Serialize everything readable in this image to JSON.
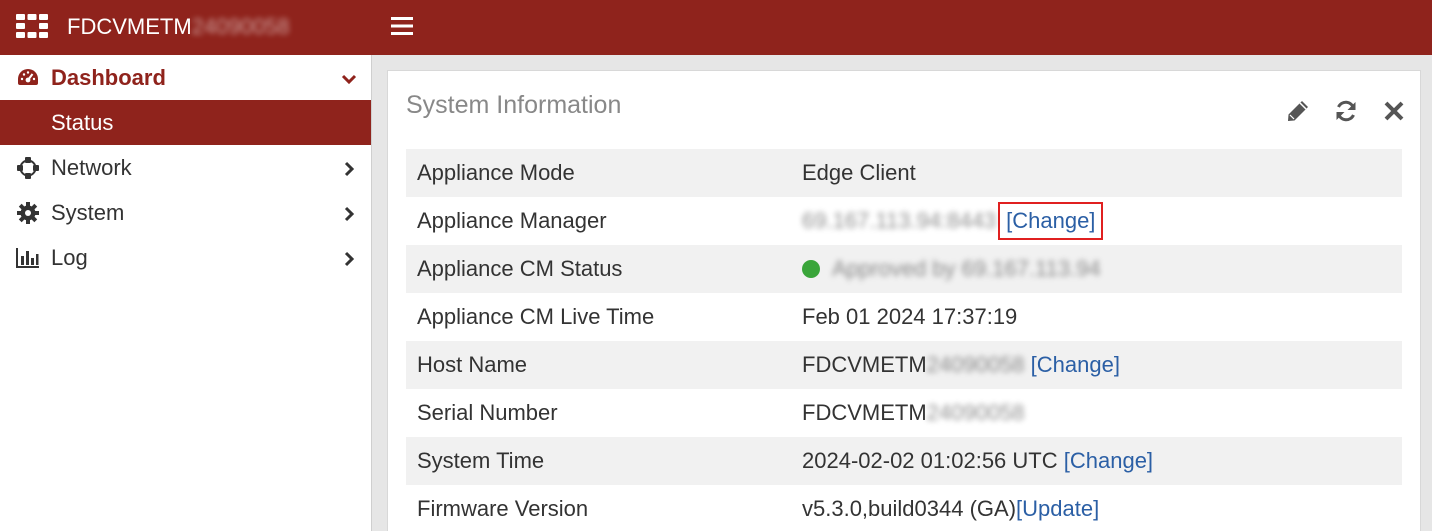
{
  "header": {
    "hostname_prefix": "FDCVMETM",
    "hostname_suffix": "24090058",
    "logo_icon": "fortinet-logo-icon",
    "menu_icon": "hamburger-menu-icon"
  },
  "sidebar": {
    "items": [
      {
        "label": "Dashboard",
        "icon": "dashboard-gauge-icon",
        "expanded": true,
        "children": [
          {
            "label": "Status",
            "selected": true
          }
        ]
      },
      {
        "label": "Network",
        "icon": "network-icon",
        "expanded": false
      },
      {
        "label": "System",
        "icon": "gear-icon",
        "expanded": false
      },
      {
        "label": "Log",
        "icon": "bar-chart-icon",
        "expanded": false
      }
    ]
  },
  "panel": {
    "title": "System Information",
    "tools": [
      "pencil-icon",
      "refresh-icon",
      "close-icon"
    ]
  },
  "system_info": {
    "rows": [
      {
        "label": "Appliance Mode",
        "value": "Edge Client"
      },
      {
        "label": "Appliance Manager",
        "value": "69.167.113.94:8443",
        "link": "[Change]"
      },
      {
        "label": "Appliance CM Status",
        "value": "Approved by 69.167.113.94"
      },
      {
        "label": "Appliance CM Live Time",
        "value": "Feb 01 2024 17:37:19"
      },
      {
        "label": "Host Name",
        "value_prefix": "FDCVMETM",
        "value_suffix": "24090058",
        "link": "[Change]"
      },
      {
        "label": "Serial Number",
        "value_prefix": "FDCVMETM",
        "value_suffix": "24090058"
      },
      {
        "label": "System Time",
        "value": "2024-02-02 01:02:56 UTC",
        "link": "[Change]"
      },
      {
        "label": "Firmware Version",
        "value": "v5.3.0,build0344 (GA)",
        "link": "[Update]"
      }
    ]
  },
  "colors": {
    "brand": "#8f231c",
    "link": "#2b5fa5",
    "status_ok": "#3aa53a",
    "highlight_box": "#e02020"
  }
}
